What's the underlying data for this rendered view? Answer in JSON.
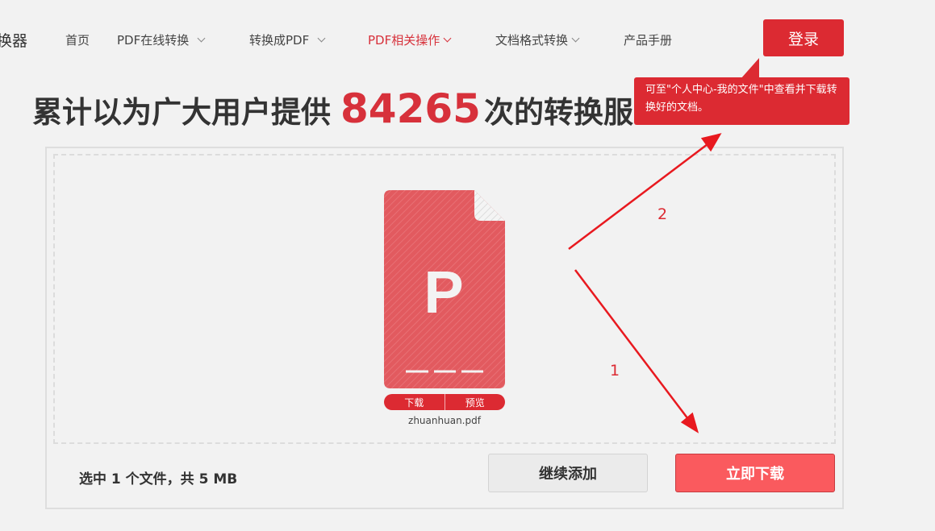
{
  "header": {
    "brand_partial": "换器",
    "nav": [
      {
        "label": "首页",
        "dropdown": false
      },
      {
        "label": "PDF在线转换",
        "dropdown": true
      },
      {
        "label": "转换成PDF",
        "dropdown": true
      },
      {
        "label": "PDF相关操作",
        "dropdown": true,
        "active": true
      },
      {
        "label": "文档格式转换",
        "dropdown": true
      },
      {
        "label": "产品手册",
        "dropdown": false
      }
    ],
    "login_label": "登录"
  },
  "headline": {
    "prefix": "累计以为广大用户提供",
    "count": "84265",
    "suffix": "次的转换服"
  },
  "tooltip": {
    "text": "可至\"个人中心-我的文件\"中查看并下载转换好的文档。"
  },
  "file": {
    "type_letter": "P",
    "download_label": "下载",
    "preview_label": "预览",
    "name": "zhuanhuan.pdf"
  },
  "footer": {
    "summary": "选中 1 个文件，共 5 MB",
    "continue_label": "继续添加",
    "download_label": "立即下载"
  },
  "annotations": {
    "step1": "1",
    "step2": "2"
  },
  "colors": {
    "accent": "#dc2a32",
    "file_red": "#e25a5f",
    "download_button": "#fa5a5e",
    "background": "#f2f2f2"
  }
}
